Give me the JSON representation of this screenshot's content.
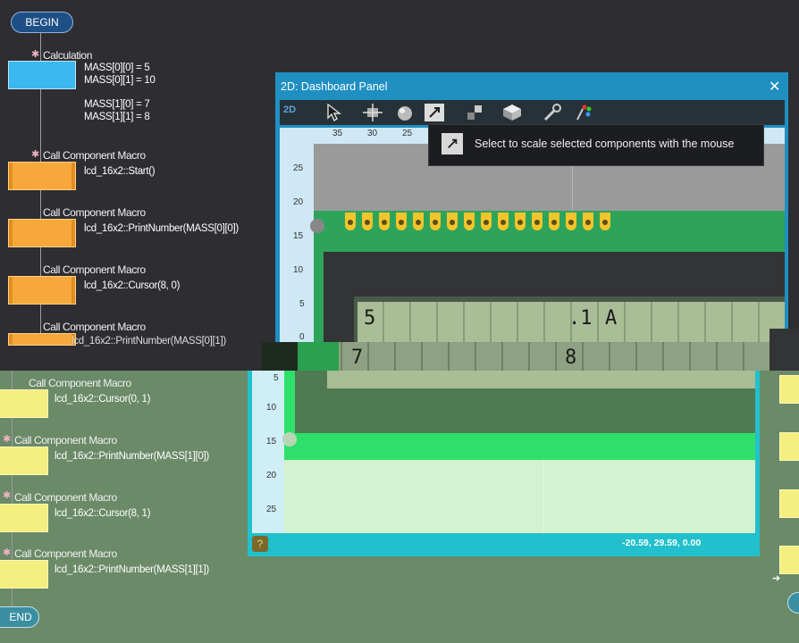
{
  "flowchart": {
    "begin": "BEGIN",
    "end": "END",
    "calc_title": "Calculation",
    "calc_lines": [
      "MASS[0][0] = 5",
      "MASS[0][1] = 10",
      "MASS[1][0] = 7",
      "MASS[1][1] = 8"
    ],
    "macro_title": "Call Component Macro",
    "macros": [
      "lcd_16x2::Start()",
      "lcd_16x2::PrintNumber(MASS[0][0])",
      "lcd_16x2::Cursor(8, 0)",
      "lcd_16x2::PrintNumber(MASS[0][1])",
      "lcd_16x2::Cursor(0, 1)",
      "lcd_16x2::PrintNumber(MASS[1][0])",
      "lcd_16x2::Cursor(8, 1)",
      "lcd_16x2::PrintNumber(MASS[1][1])"
    ]
  },
  "panel": {
    "title": "2D: Dashboard Panel",
    "close": "✕",
    "view_label": "2D",
    "tooltip": "Select to scale selected components with the mouse",
    "ruler_top": [
      "35",
      "30",
      "25"
    ],
    "ruler_left": [
      "25",
      "20",
      "15",
      "10",
      "5",
      "0"
    ],
    "lcd_row1": {
      "a": "5",
      "b": ".1",
      "c": "A"
    },
    "lcd_row2": {
      "a": "7",
      "b": "8"
    }
  },
  "panel_lower": {
    "ruler_left": [
      "5",
      "10",
      "15",
      "20",
      "25"
    ],
    "coords": "-20.59, 29.59, 0.00",
    "help": "?"
  },
  "colors": {
    "accent": "#1f8fc2",
    "flow_bg": "#2e2d31",
    "block_orange": "#f6a93a",
    "block_yellow": "#f4ef7f"
  }
}
